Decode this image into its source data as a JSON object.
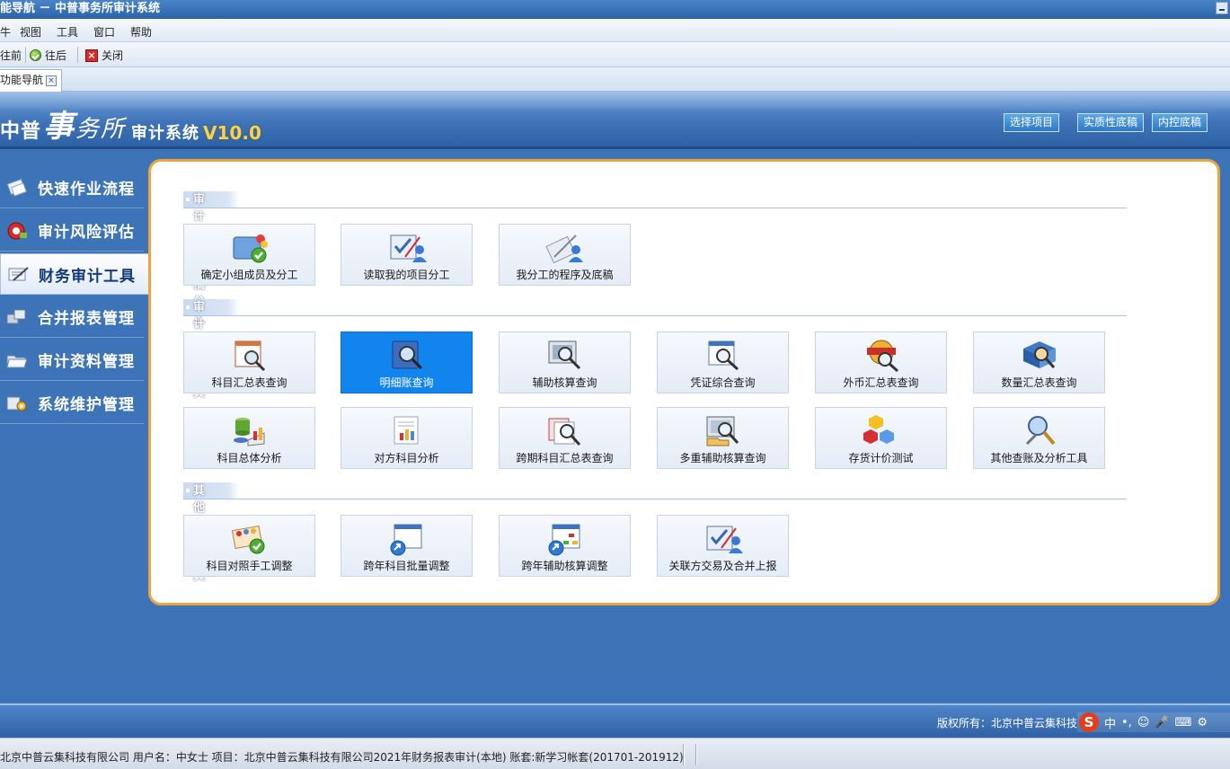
{
  "window": {
    "title": "能导航 － 中普事务所审计系统"
  },
  "menu": {
    "items": [
      "牛",
      "视图",
      "工具",
      "窗口",
      "帮助"
    ]
  },
  "toolbar": {
    "forward": "往前",
    "back": "往后",
    "close": "关闭"
  },
  "tab": {
    "label": "功能导航"
  },
  "banner": {
    "logo": {
      "p1": "中普",
      "p2": "事",
      "p3": "务所",
      "p4": "审计系统",
      "p5": "V10.0"
    },
    "buttons": [
      "选择项目",
      "实质性底稿",
      "内控底稿"
    ]
  },
  "nav": {
    "items": [
      {
        "label": "快速作业流程",
        "icon": "workflow-icon"
      },
      {
        "label": "审计风险评估",
        "icon": "risk-icon"
      },
      {
        "label": "财务审计工具",
        "icon": "audit-tool-icon",
        "active": true
      },
      {
        "label": "合并报表管理",
        "icon": "consolidation-icon"
      },
      {
        "label": "审计资料管理",
        "icon": "folder-icon"
      },
      {
        "label": "系统维护管理",
        "icon": "maintenance-icon"
      }
    ]
  },
  "sections": [
    {
      "title": "审计项目底稿分工",
      "tiles": [
        "确定小组成员及分工",
        "读取我的项目分工",
        "我分工的程序及底稿"
      ]
    },
    {
      "title": "审计查账工具",
      "tiles": [
        "科目汇总表查询",
        "明细账查询",
        "辅助核算查询",
        "凭证综合查询",
        "外币汇总表查询",
        "数量汇总表查询",
        "科目总体分析",
        "对方科目分析",
        "跨期科目汇总表查询",
        "多重辅助核算查询",
        "存货计价测试",
        "其他查账及分析工具"
      ]
    },
    {
      "title": "其他审计工具",
      "tiles": [
        "科目对照手工调整",
        "跨年科目批量调整",
        "跨年辅助核算调整",
        "关联方交易及合并上报"
      ]
    }
  ],
  "footer": {
    "copyright": "版权所有：北京中普云集科技",
    "ime": [
      "中",
      "•,",
      "☺",
      "🎤",
      "⌨",
      "⚙"
    ]
  },
  "status": {
    "text": "北京中普云集科技有限公司 用户名：中女士 项目：北京中普云集科技有限公司2021年财务报表审计(本地)   账套:新学习帐套(201701-201912)"
  },
  "colors": {
    "accent": "#f0a23c",
    "selected": "#1284ee",
    "nav_bg": "#3d74b8"
  }
}
